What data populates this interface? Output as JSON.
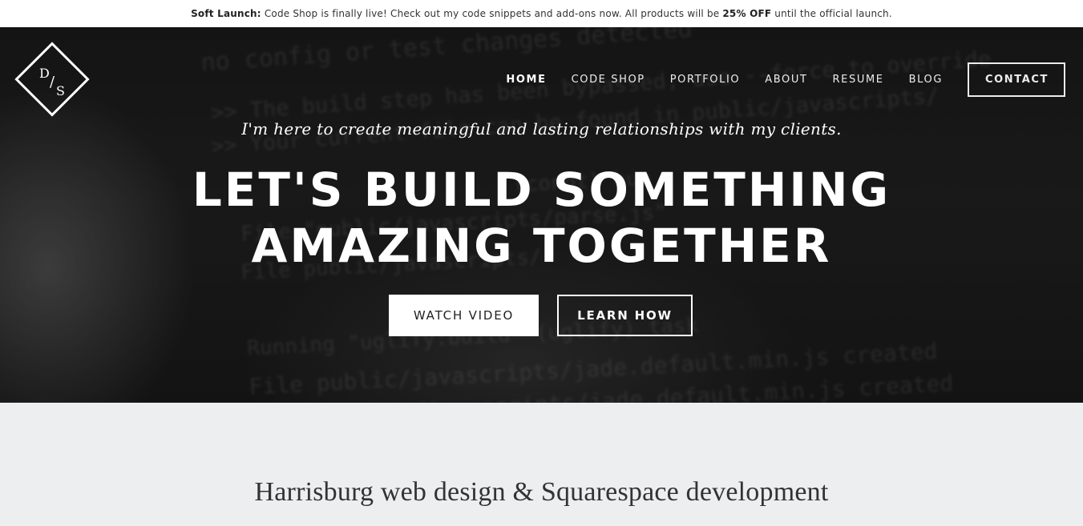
{
  "announcement": {
    "prefix": "Soft Launch:",
    "text_1": " Code Shop is finally live! Check out my code snippets and add-ons now. All products will be ",
    "highlight": "25% OFF",
    "text_2": " until the official launch."
  },
  "logo": {
    "letter_top": "D",
    "separator": "/",
    "letter_bottom": "S"
  },
  "nav": {
    "items": [
      {
        "label": "HOME"
      },
      {
        "label": "CODE SHOP"
      },
      {
        "label": "PORTFOLIO"
      },
      {
        "label": "ABOUT"
      },
      {
        "label": "RESUME"
      },
      {
        "label": "BLOG"
      }
    ],
    "contact": "CONTACT",
    "active": "HOME"
  },
  "hero": {
    "tagline": "I'm here to create meaningful and lasting relationships with my clients.",
    "headline_line1": "LET'S BUILD SOMETHING",
    "headline_line2": "AMAZING TOGETHER",
    "primary_button": "WATCH VIDEO",
    "secondary_button": "LEARN HOW",
    "background_code": [
      "no config or test changes detected",
      ">> The build step has been bypassed, use --force to override",
      ">> Your current file can be found in public/javascripts/",
      "(conot) bun",
      "File \"public/javascripts/parse.js\"",
      "File public/javascripts/",
      "Running \"uglify:build\" (uglify) task",
      "File public/javascripts/jade.default.min.js created",
      "File public/javascripts/jade.default.min.js created"
    ]
  },
  "section": {
    "heading": "Harrisburg web design & Squarespace development"
  },
  "colors": {
    "hero_bg": "#141414",
    "section_bg": "#eceef0",
    "text_light": "#ffffff"
  }
}
